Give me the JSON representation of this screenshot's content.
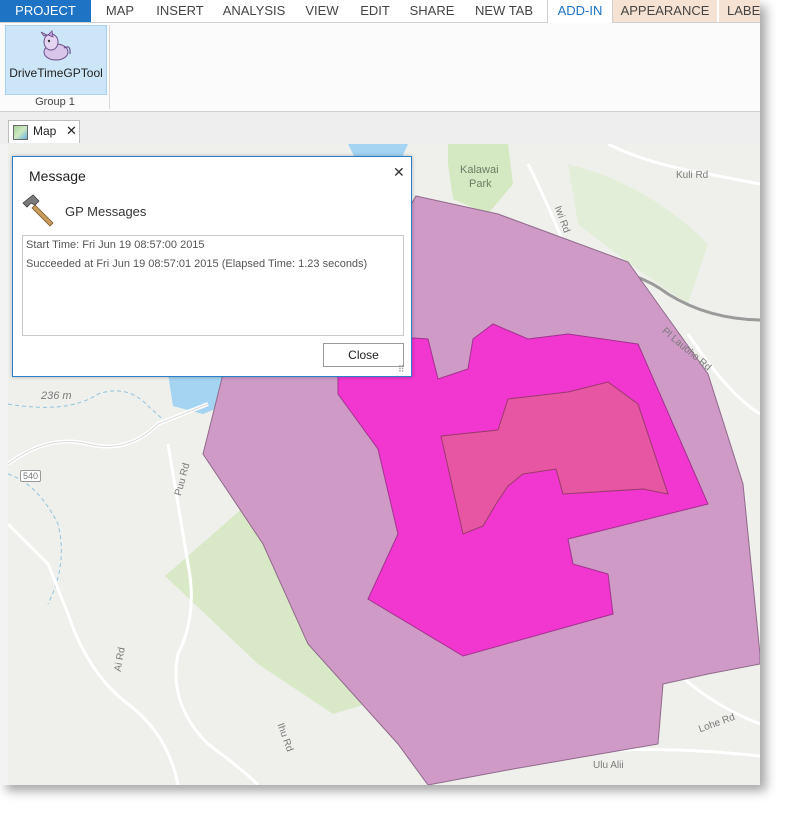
{
  "ribbon": {
    "tabs": [
      {
        "label": "PROJECT"
      },
      {
        "label": "MAP"
      },
      {
        "label": "INSERT"
      },
      {
        "label": "ANALYSIS"
      },
      {
        "label": "VIEW"
      },
      {
        "label": "EDIT"
      },
      {
        "label": "SHARE"
      },
      {
        "label": "NEW TAB"
      },
      {
        "label": "ADD-IN"
      },
      {
        "label": "APPEARANCE"
      },
      {
        "label": "LABE"
      }
    ],
    "active_tab": "ADD-IN",
    "tool_button": {
      "label": "DriveTimeGPTool",
      "icon": "unicorn-icon"
    },
    "group_label": "Group 1"
  },
  "view": {
    "tab_label": "Map",
    "tab_icon": "map-icon",
    "close_glyph": "✕"
  },
  "map": {
    "labels": {
      "kalawai": "Kalawai",
      "park": "Park",
      "kuli_rd": "Kuli Rd",
      "iwi_rd": "Iwi Rd",
      "lauoho_rd": "Pl Lauoho Rd",
      "elev": "236 m",
      "route": "540",
      "puu_rd": "Puu Rd",
      "ai_rd": "Ai Rd",
      "ihu_rd": "Ihu Rd",
      "lohe_rd": "Lohe Rd",
      "ulu_alii": "Ulu Alii"
    },
    "colors": {
      "outer_polygon": "#cf9ac6",
      "middle_polygon": "#f236d0",
      "inner_polygon": "#e756a2",
      "water": "#a5d4f3",
      "park": "#d4e8c2"
    }
  },
  "dialog": {
    "title": "Message",
    "close_glyph": "✕",
    "icon": "hammer-icon",
    "subtitle": "GP Messages",
    "messages": [
      "Start Time: Fri Jun 19 08:57:00 2015",
      "Succeeded at Fri Jun 19 08:57:01 2015 (Elapsed Time: 1.23 seconds)"
    ],
    "close_button": "Close",
    "grip": "⠿"
  },
  "accent": "#1e73c5"
}
